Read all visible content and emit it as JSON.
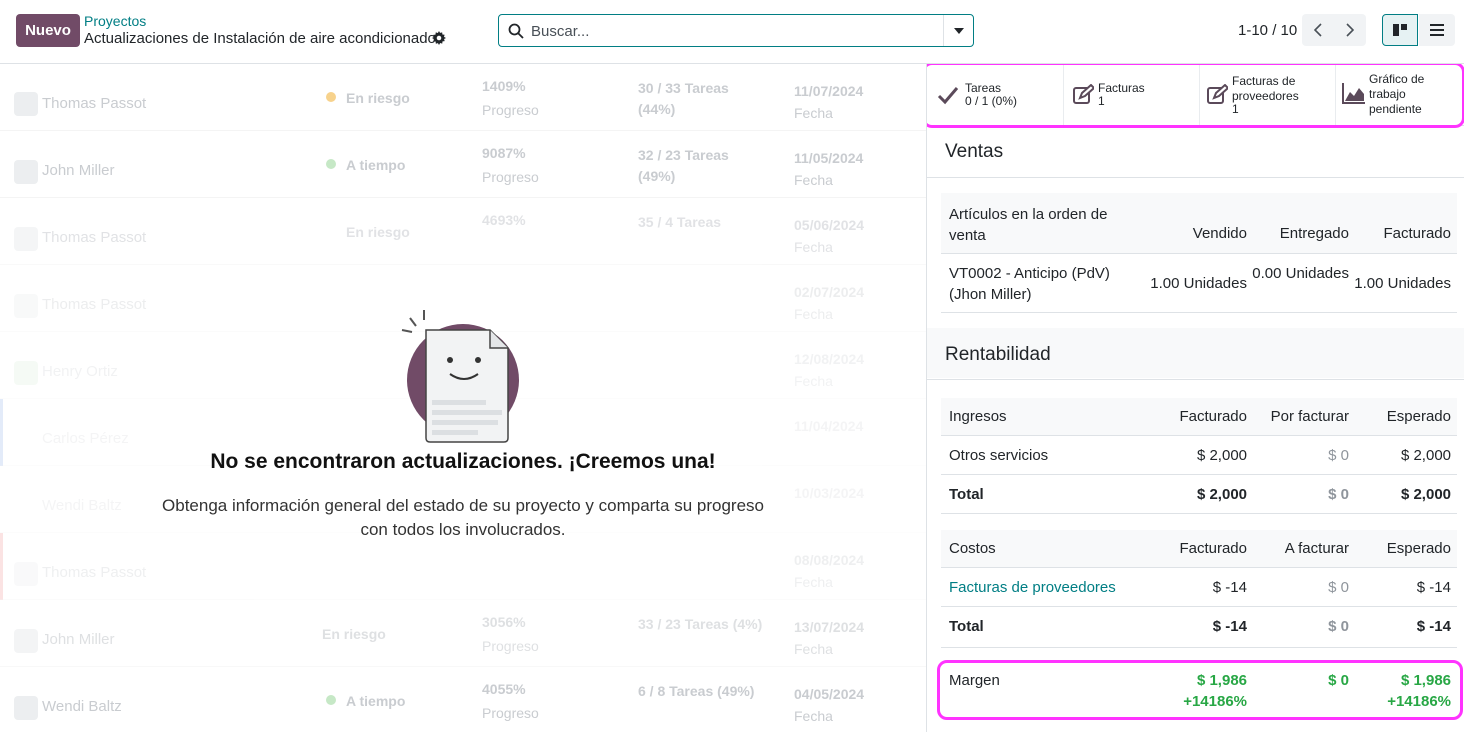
{
  "topbar": {
    "new_label": "Nuevo",
    "breadcrumb_parent": "Proyectos",
    "breadcrumb_current": "Actualizaciones de Instalación de aire acondicionado",
    "search_placeholder": "Buscar...",
    "pager": "1-10 / 10"
  },
  "list": {
    "rows": [
      {
        "name": "Thomas Passot",
        "status": "En riesgo",
        "pct": "1409%",
        "pct_label": "Progreso",
        "tasks": "30 / 33 Tareas (44%)",
        "date": "11/07/2024",
        "date_label": "Fecha"
      },
      {
        "name": "John Miller",
        "status": "A tiempo",
        "pct": "9087%",
        "pct_label": "Progreso",
        "tasks": "32 / 23 Tareas (49%)",
        "date": "11/05/2024",
        "date_label": "Fecha"
      },
      {
        "name": "Thomas Passot",
        "status": "En riesgo",
        "pct": "4693%",
        "pct_label": "",
        "tasks": "35 / 4 Tareas",
        "date": "05/06/2024",
        "date_label": "Fecha"
      },
      {
        "name": "Thomas Passot",
        "status": "",
        "pct": "",
        "pct_label": "",
        "tasks": "",
        "date": "02/07/2024",
        "date_label": "Fecha"
      },
      {
        "name": "Henry Ortiz",
        "status": "",
        "pct": "",
        "pct_label": "",
        "tasks": "",
        "date": "12/08/2024",
        "date_label": "Fecha"
      },
      {
        "name": "Carlos Pérez",
        "status": "",
        "pct": "",
        "pct_label": "",
        "tasks": "",
        "date": "11/04/2024",
        "date_label": "Fecha"
      },
      {
        "name": "Wendi Baltz",
        "status": "",
        "pct": "",
        "pct_label": "",
        "tasks": "",
        "date": "10/03/2024",
        "date_label": "Fecha"
      },
      {
        "name": "Thomas Passot",
        "status": "",
        "pct": "",
        "pct_label": "",
        "tasks": "",
        "date": "08/08/2024",
        "date_label": "Fecha"
      },
      {
        "name": "John Miller",
        "status": "En riesgo",
        "pct": "3056%",
        "pct_label": "Progreso",
        "tasks": "33 / 23 Tareas (4%)",
        "date": "13/07/2024",
        "date_label": "Fecha"
      },
      {
        "name": "Wendi Baltz",
        "status": "A tiempo",
        "pct": "4055%",
        "pct_label": "Progreso",
        "tasks": "6 / 8 Tareas (49%)",
        "date": "04/05/2024",
        "date_label": "Fecha"
      }
    ]
  },
  "empty_state": {
    "title": "No se encontraron actualizaciones. ¡Creemos una!",
    "text": "Obtenga información general del estado de su proyecto y comparta su progreso con todos los involucrados."
  },
  "side": {
    "stats": [
      {
        "label": "Tareas",
        "value": "0 / 1 (0%)",
        "icon": "check-icon"
      },
      {
        "label": "Facturas",
        "value": "1",
        "icon": "edit-icon"
      },
      {
        "label": "Facturas de proveedores",
        "value": "1",
        "icon": "edit-icon"
      },
      {
        "label": "Gráfico de trabajo pendiente",
        "value": "",
        "icon": "area-chart-icon"
      }
    ],
    "sales": {
      "title": "Ventas",
      "headers": [
        "Artículos en la orden de venta",
        "Vendido",
        "Entregado",
        "Facturado"
      ],
      "rows": [
        {
          "item": "VT0002 - Anticipo (PdV) (Jhon Miller)",
          "sold": "1.00 Unidades",
          "delivered": "0.00 Unidades",
          "invoiced": "1.00 Unidades"
        }
      ]
    },
    "profitability": {
      "title": "Rentabilidad",
      "revenue_headers": [
        "Ingresos",
        "Facturado",
        "Por facturar",
        "Esperado"
      ],
      "revenue_rows": [
        {
          "label": "Otros servicios",
          "invoiced": "$ 2,000",
          "to_invoice": "$ 0",
          "expected": "$ 2,000"
        }
      ],
      "revenue_total": {
        "label": "Total",
        "invoiced": "$ 2,000",
        "to_invoice": "$ 0",
        "expected": "$ 2,000"
      },
      "cost_headers": [
        "Costos",
        "Facturado",
        "A facturar",
        "Esperado"
      ],
      "cost_rows": [
        {
          "label": "Facturas de proveedores",
          "invoiced": "$ -14",
          "to_invoice": "$ 0",
          "expected": "$ -14"
        }
      ],
      "cost_total": {
        "label": "Total",
        "invoiced": "$ -14",
        "to_invoice": "$ 0",
        "expected": "$ -14"
      },
      "margin": {
        "label": "Margen",
        "invoiced": "$ 1,986",
        "invoiced_pct": "+14186%",
        "to_invoice": "$ 0",
        "expected": "$ 1,986",
        "expected_pct": "+14186%"
      }
    }
  },
  "colors": {
    "brand": "#714b67",
    "accent": "#017e84",
    "highlight": "#ff33ff",
    "positive": "#28a745"
  }
}
